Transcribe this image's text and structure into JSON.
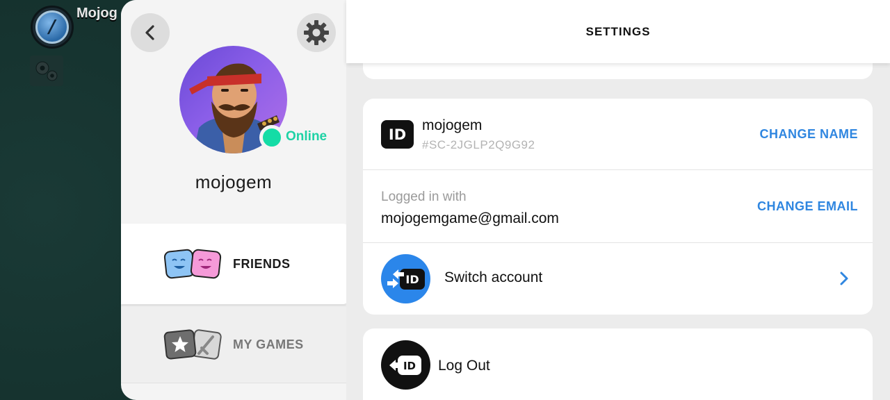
{
  "game": {
    "player_name": "Mojog",
    "avatar_letter": "/",
    "icons": {
      "settings": "gears-icon"
    }
  },
  "profile": {
    "back_icon": "chevron-left-icon",
    "settings_icon": "gear-icon",
    "username": "mojogem",
    "status": "Online",
    "status_color": "#14dca6",
    "nav": [
      {
        "label": "FRIENDS",
        "icon": "friends-faces-icon",
        "active": true
      },
      {
        "label": "MY GAMES",
        "icon": "games-cards-icon",
        "active": false
      }
    ]
  },
  "settings": {
    "title": "SETTINGS",
    "account": {
      "id_badge": "ID",
      "name": "mojogem",
      "tag": "#SC-2JGLP2Q9G92",
      "change_name": "CHANGE NAME",
      "login_caption": "Logged in with",
      "email": "mojogemgame@gmail.com",
      "change_email": "CHANGE EMAIL",
      "switch_label": "Switch account",
      "switch_icon": "switch-account-icon",
      "switch_badge": "ID"
    },
    "logout": {
      "label": "Log Out",
      "icon": "logout-icon",
      "badge": "ID"
    },
    "colors": {
      "link": "#2f86e0",
      "switch_bg": "#2b86ea",
      "online": "#14dca6"
    }
  }
}
